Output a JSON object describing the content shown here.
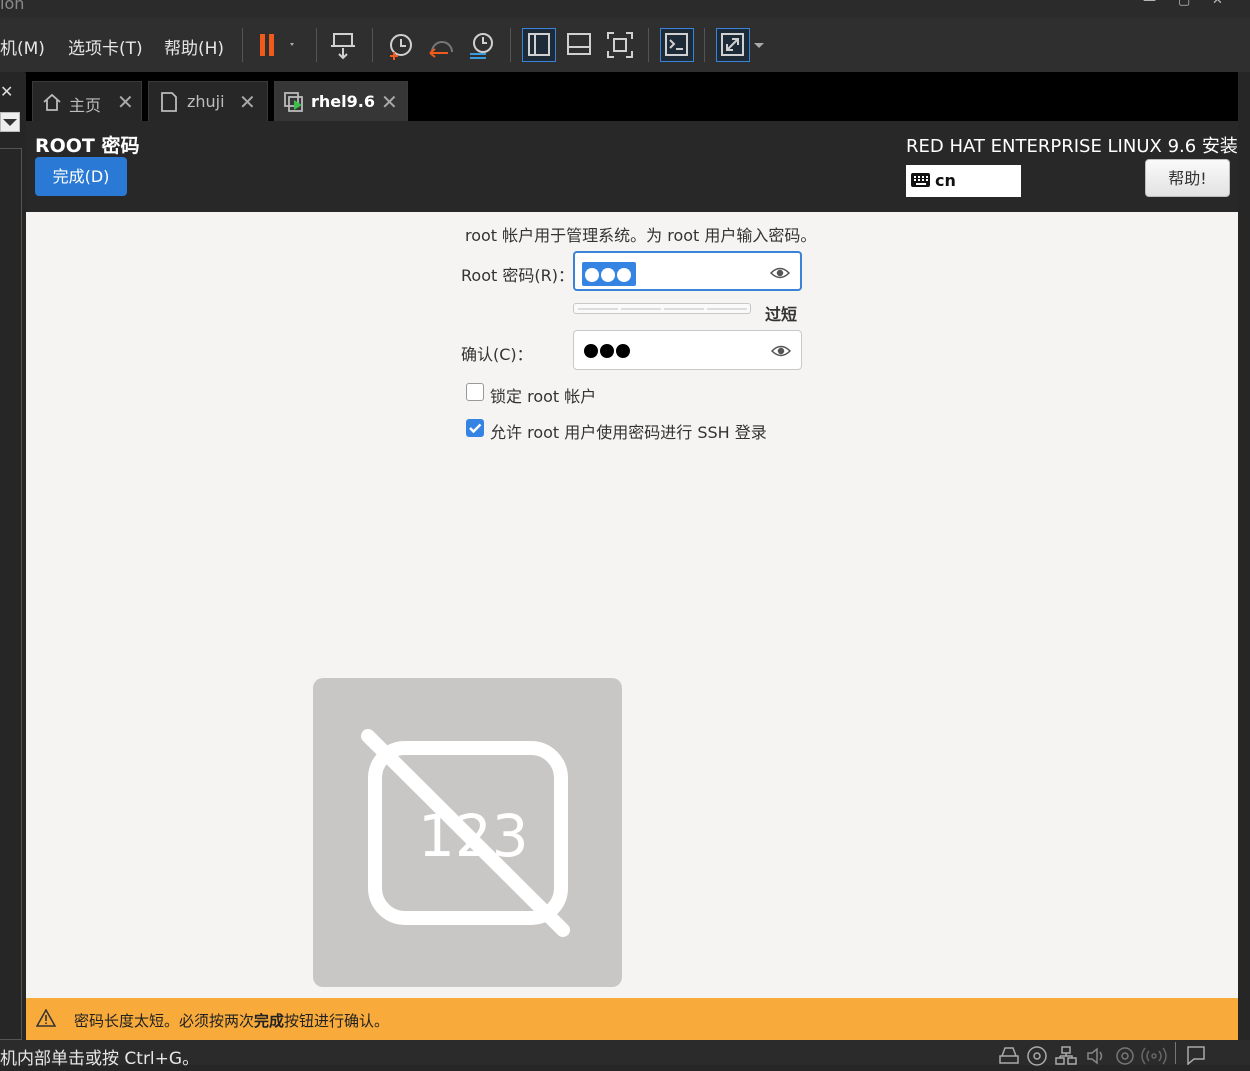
{
  "window": {
    "title_fragment": "ion"
  },
  "menu": {
    "vm": "机(M)",
    "tabs": "选项卡(T)",
    "help": "帮助(H)"
  },
  "tabs": [
    {
      "label": "主页"
    },
    {
      "label": "zhuji"
    },
    {
      "label": "rhel9.6"
    }
  ],
  "installer": {
    "page_title": "ROOT 密码",
    "done_button": "完成(D)",
    "product_title": "RED HAT ENTERPRISE LINUX 9.6 安装",
    "keyboard_layout": "cn",
    "help_button": "帮助!",
    "description": "root 帐户用于管理系统。为 root 用户输入密码。",
    "password_label": "Root 密码(R)：",
    "confirm_label": "确认(C)：",
    "strength_text": "过短",
    "strength_level": 0,
    "lock_root_label": "锁定 root 帐户",
    "lock_root_checked": false,
    "allow_ssh_label": "允许 root 用户使用密码进行 SSH 登录",
    "allow_ssh_checked": true,
    "warning_pre": "密码长度太短。必须按两次",
    "warning_bold": "完成",
    "warning_post": "按钮进行确认。",
    "overlay_icon": "numeric-keypad-disabled-icon"
  },
  "statusbar": {
    "hint": "机内部单击或按 Ctrl+G。"
  },
  "colors": {
    "accent": "#3584e4",
    "warning": "#f8ab3a",
    "pause": "#f05a1a"
  }
}
